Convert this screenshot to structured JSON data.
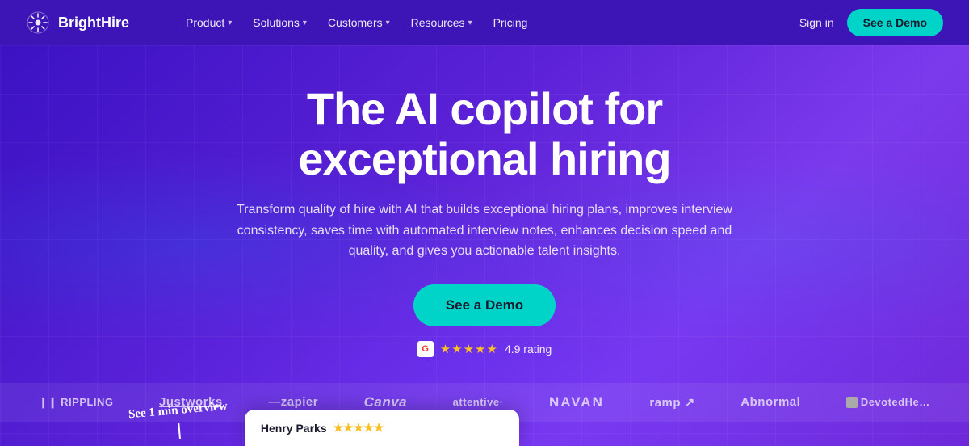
{
  "logo": {
    "name": "BrightHire",
    "icon_label": "brighthire-logo-icon"
  },
  "nav": {
    "links": [
      {
        "label": "Product",
        "has_dropdown": true
      },
      {
        "label": "Solutions",
        "has_dropdown": true
      },
      {
        "label": "Customers",
        "has_dropdown": true
      },
      {
        "label": "Resources",
        "has_dropdown": true
      },
      {
        "label": "Pricing",
        "has_dropdown": false
      }
    ],
    "sign_in": "Sign in",
    "cta": "See a Demo"
  },
  "hero": {
    "title_line1": "The AI copilot for",
    "title_line2": "exceptional hiring",
    "subtitle": "Transform quality of hire with AI that builds exceptional hiring plans, improves interview consistency, saves time with automated interview notes, enhances decision speed and quality, and gives you actionable talent insights.",
    "cta_label": "See a Demo",
    "rating_text": "4.9 rating",
    "rating_stars": "★★★★★"
  },
  "logos": [
    {
      "label": "❙❙ RIPPLING",
      "class": "rippling"
    },
    {
      "label": "Justworks",
      "class": "justworks"
    },
    {
      "label": "zapier",
      "class": "zapier"
    },
    {
      "label": "Canva",
      "class": "canva"
    },
    {
      "label": "attentive·",
      "class": "attentive"
    },
    {
      "label": "navan",
      "class": "navan"
    },
    {
      "label": "ramp ↗",
      "class": "ramp"
    },
    {
      "label": "Abnormal",
      "class": "abnormal"
    },
    {
      "label": "DevotedHealth",
      "class": "devoted"
    }
  ],
  "bottom": {
    "handwritten": "See 1 min\noverview",
    "review_name": "Henry Parks",
    "review_stars": "★★★★★"
  }
}
